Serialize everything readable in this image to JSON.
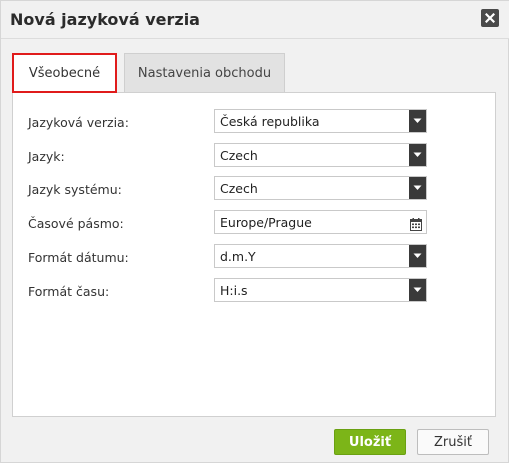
{
  "dialog": {
    "title": "Nová jazyková verzia"
  },
  "tabs": [
    {
      "label": "Všeobecné",
      "active": true
    },
    {
      "label": "Nastavenia obchodu",
      "active": false
    }
  ],
  "form": {
    "language_version": {
      "label": "Jazyková verzia:",
      "value": "Česká republika"
    },
    "language": {
      "label": "Jazyk:",
      "value": "Czech"
    },
    "system_language": {
      "label": "Jazyk systému:",
      "value": "Czech"
    },
    "timezone": {
      "label": "Časové pásmo:",
      "value": "Europe/Prague"
    },
    "date_format": {
      "label": "Formát dátumu:",
      "value": "d.m.Y"
    },
    "time_format": {
      "label": "Formát času:",
      "value": "H:i.s"
    }
  },
  "buttons": {
    "save": "Uložiť",
    "cancel": "Zrušiť"
  },
  "colors": {
    "save_button": "#7cb518",
    "active_tab_border": "#e01b1b",
    "select_caret": "#3a3a3a"
  },
  "icons": {
    "close": "close-icon",
    "dropdown": "chevron-down-icon",
    "calendar": "calendar-icon"
  }
}
